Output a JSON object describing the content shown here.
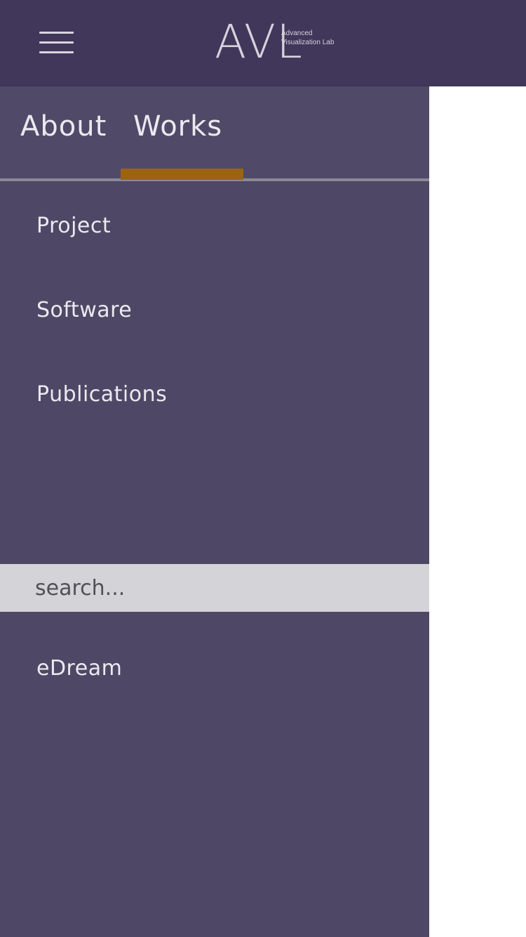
{
  "header": {
    "logo_text": "AVL",
    "logo_subtitle_line1": "Advanced",
    "logo_subtitle_line2": "Visualization Lab",
    "menu_icon": "hamburger-menu-icon",
    "background_color": "#41375b"
  },
  "drawer": {
    "background_color": "#4e4866",
    "tabs": [
      {
        "label": "About",
        "active": false
      },
      {
        "label": "Works",
        "active": true
      }
    ],
    "active_indicator_color": "#9a6412",
    "items": [
      {
        "label": "Project"
      },
      {
        "label": "Software"
      },
      {
        "label": "Publications"
      }
    ],
    "search": {
      "placeholder": "search...",
      "value": ""
    },
    "footer_items": [
      {
        "label": "eDream"
      }
    ]
  }
}
